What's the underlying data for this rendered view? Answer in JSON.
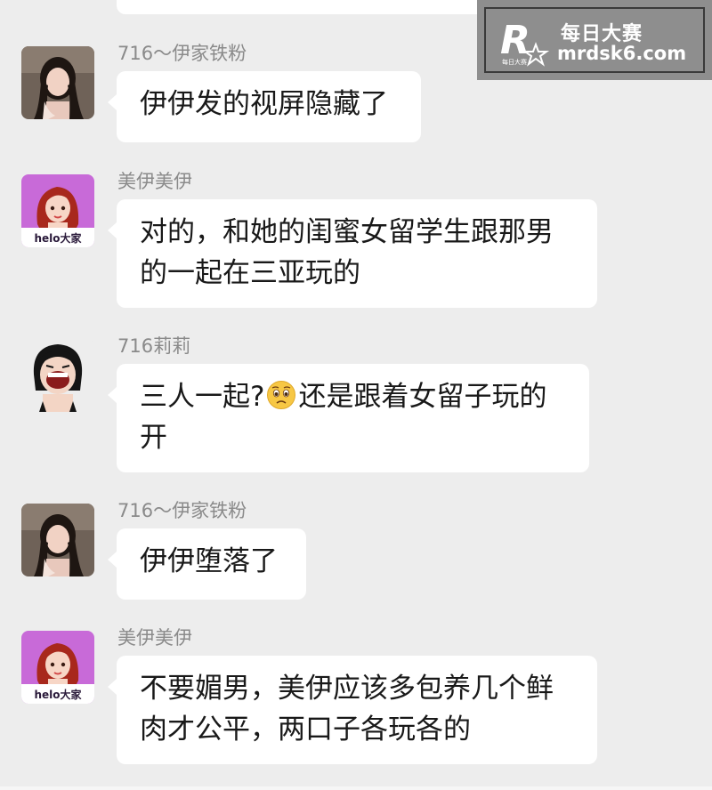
{
  "watermark": {
    "title": "每日大赛",
    "url": "mrdsk6.com",
    "logo_text": "每日大赛"
  },
  "messages": [
    {
      "sender": "716～伊家铁粉",
      "lines": [
        "伊伊发的视屏隐藏了"
      ]
    },
    {
      "sender": "美伊美伊",
      "lines": [
        "对的，和她的闺蜜女留学生跟那男",
        "的一起在三亚玩的"
      ]
    },
    {
      "sender": "716莉莉",
      "line1_before": "三人一起?",
      "line1_after": "还是跟着女留子玩的",
      "line2": "开"
    },
    {
      "sender": "716～伊家铁粉",
      "lines": [
        "伊伊堕落了"
      ]
    },
    {
      "sender": "美伊美伊",
      "lines": [
        "不要媚男，美伊应该多包养几个鲜",
        "肉才公平，两口子各玩各的"
      ]
    }
  ],
  "avatars": {
    "meiyi_badge": "helo大家"
  },
  "colors": {
    "background": "#ededed",
    "bubble": "#ffffff",
    "sender_name": "#8a8a8a",
    "text": "#191919",
    "meiyi_avatar_bg": "#c86ad8"
  }
}
